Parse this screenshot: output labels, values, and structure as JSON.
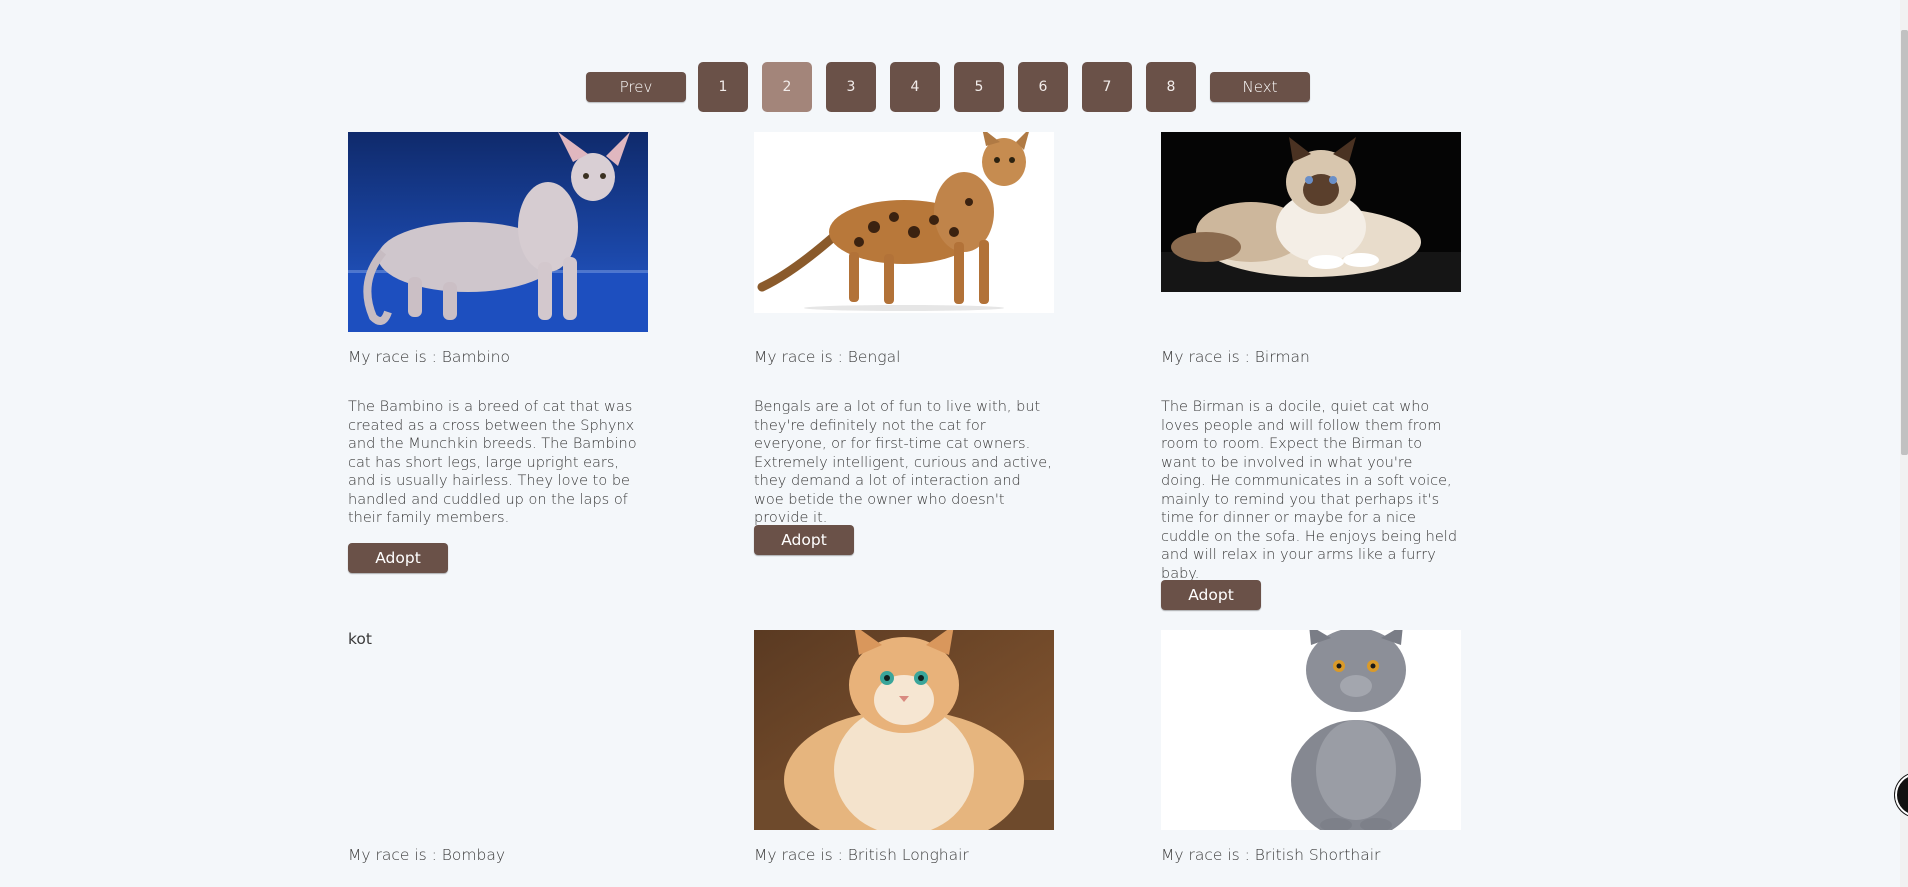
{
  "pagination": {
    "prev_label": "Prev",
    "next_label": "Next",
    "pages": [
      "1",
      "2",
      "3",
      "4",
      "5",
      "6",
      "7",
      "8"
    ],
    "active_page": "2"
  },
  "cards": [
    {
      "race_label": "My race is : Bambino",
      "description": "The Bambino is a breed of cat that was created as a cross between the Sphynx and the Munchkin breeds. The Bambino cat has short legs, large upright ears, and is usually hairless. They love to be handled and cuddled up on the laps of their family members.",
      "button_label": "Adopt"
    },
    {
      "race_label": "My race is : Bengal",
      "description": "Bengals are a lot of fun to live with, but they're definitely not the cat for everyone, or for first-time cat owners. Extremely intelligent, curious and active, they demand a lot of interaction and woe betide the owner who doesn't provide it.",
      "button_label": "Adopt"
    },
    {
      "race_label": "My race is : Birman",
      "description": "The Birman is a docile, quiet cat who loves people and will follow them from room to room. Expect the Birman to want to be involved in what you're doing. He communicates in a soft voice, mainly to remind you that perhaps it's time for dinner or maybe for a nice cuddle on the sofa. He enjoys being held and will relax in your arms like a furry baby.",
      "button_label": "Adopt"
    },
    {
      "image_alt": "kot",
      "race_label": "My race is : Bombay"
    },
    {
      "race_label": "My race is : British Longhair"
    },
    {
      "race_label": "My race is : British Shorthair"
    }
  ]
}
